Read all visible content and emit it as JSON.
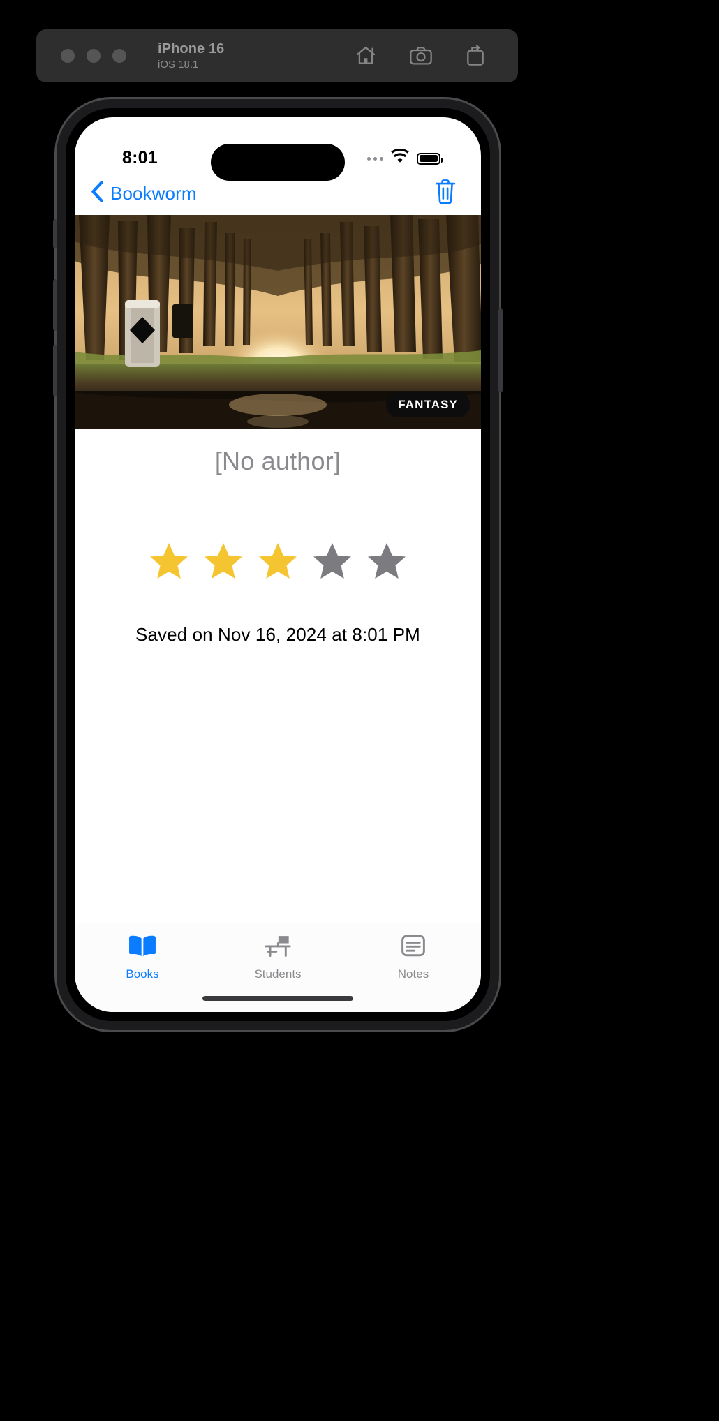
{
  "simulator": {
    "device_name": "iPhone 16",
    "os_version": "iOS 18.1",
    "window_controls": [
      "close",
      "minimize",
      "zoom"
    ],
    "actions": [
      {
        "name": "home-icon",
        "label": "Home"
      },
      {
        "name": "screenshot-icon",
        "label": "Screenshot"
      },
      {
        "name": "rotate-icon",
        "label": "Rotate"
      }
    ]
  },
  "status_bar": {
    "time": "8:01",
    "cellular": "signal-dots",
    "wifi": "wifi-icon",
    "battery": "battery-full-icon"
  },
  "nav_bar": {
    "back_label": "Bookworm",
    "back_icon": "chevron-left-icon",
    "delete_icon": "trash-icon",
    "accent_color": "#0a7cff"
  },
  "book": {
    "cover_alt": "sunlit forest path with tall trees and reflecting puddle",
    "genre": "FANTASY",
    "author": "[No author]",
    "rating": 3,
    "max_rating": 5,
    "star_filled_color": "#f5c531",
    "star_empty_color": "#7b7b80",
    "saved_on": "Saved on Nov 16, 2024 at 8:01 PM"
  },
  "tab_bar": {
    "items": [
      {
        "label": "Books",
        "icon": "book-open-icon",
        "active": true
      },
      {
        "label": "Students",
        "icon": "desk-chair-icon",
        "active": false
      },
      {
        "label": "Notes",
        "icon": "note-lines-icon",
        "active": false
      }
    ]
  }
}
